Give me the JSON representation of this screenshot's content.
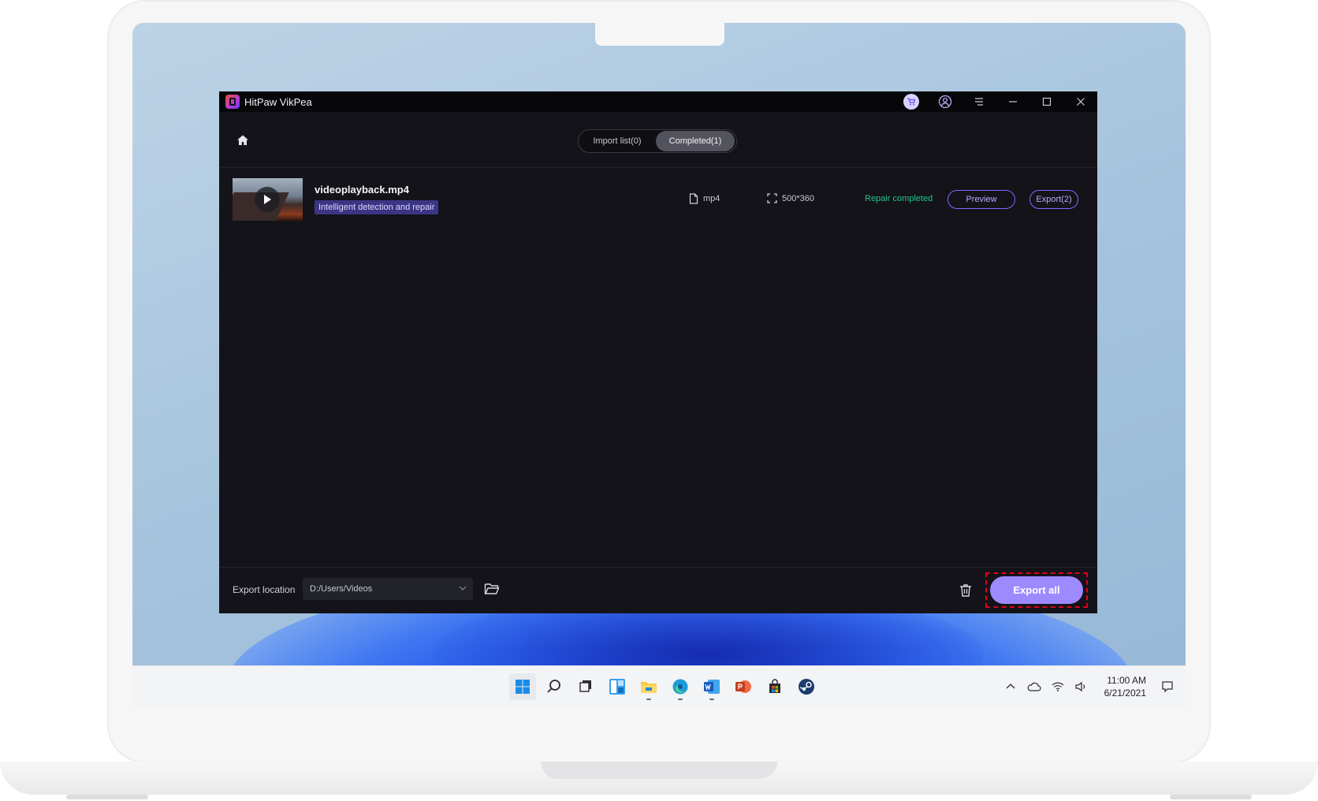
{
  "app": {
    "title": "HitPaw VikPea"
  },
  "tabs": {
    "import_list": "Import list(0)",
    "completed": "Completed(1)"
  },
  "file": {
    "name": "videoplayback.mp4",
    "mode_badge": "Intelligent detection and repair",
    "format": "mp4",
    "resolution": "500*360",
    "status": "Repair completed",
    "preview_label": "Preview",
    "export_label": "Export(2)"
  },
  "footer": {
    "export_location_label": "Export location",
    "export_location_value": "D:/Users/Videos",
    "export_all_label": "Export all"
  },
  "taskbar": {
    "time": "11:00 AM",
    "date": "6/21/2021"
  },
  "colors": {
    "accent": "#9d8aff",
    "status_green": "#25c58d",
    "app_bg": "#131319",
    "badge_bg": "#3c3584",
    "highlight_border": "#e0001a"
  }
}
